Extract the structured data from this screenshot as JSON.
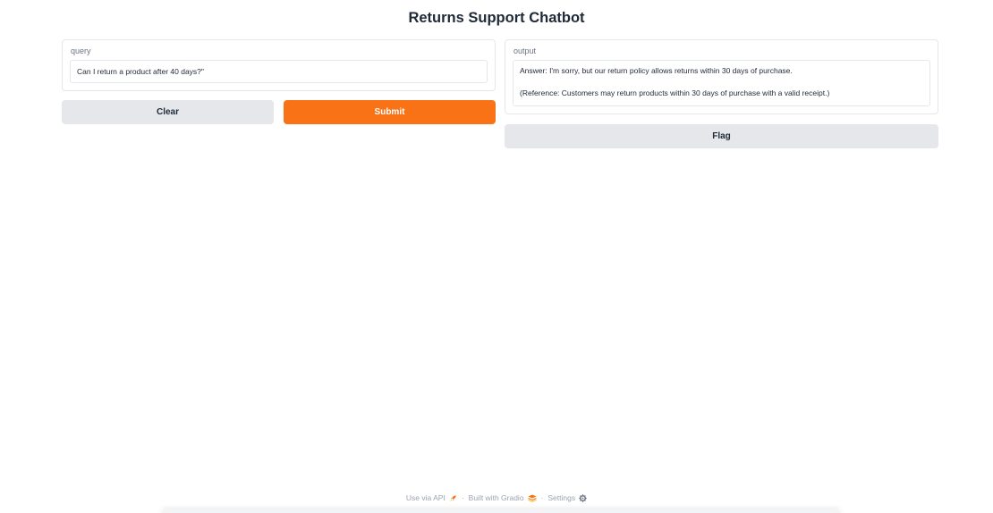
{
  "title": "Returns Support Chatbot",
  "input_panel": {
    "label": "query",
    "value": "Can I return a product after 40 days?\""
  },
  "output_panel": {
    "label": "output",
    "answer_line": "Answer: I'm sorry, but our return policy allows returns within 30 days of purchase.",
    "reference_line": "(Reference: Customers may return products within 30 days of purchase with a valid receipt.)"
  },
  "buttons": {
    "clear": "Clear",
    "submit": "Submit",
    "flag": "Flag"
  },
  "footer": {
    "api": "Use via API",
    "built": "Built with Gradio",
    "settings": "Settings",
    "separator": "·"
  },
  "colors": {
    "primary": "#f97316",
    "secondary": "#e5e7eb",
    "border": "#e5e7eb"
  },
  "icons": {
    "api": "rocket-icon",
    "built": "gradio-logo-icon",
    "settings": "gear-icon"
  }
}
